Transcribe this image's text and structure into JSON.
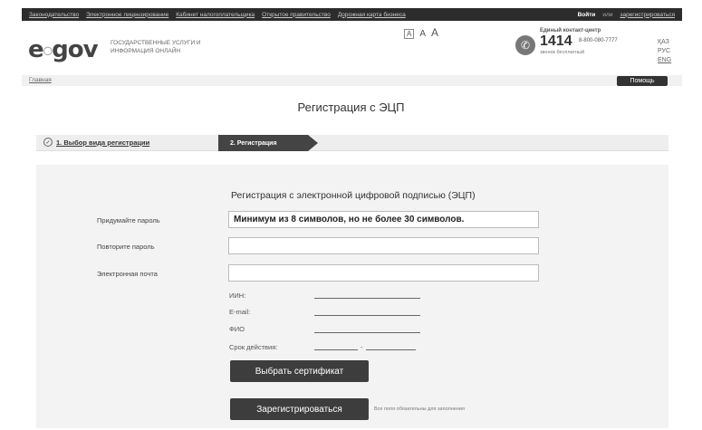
{
  "topnav": {
    "links": [
      "Законодательство",
      "Электронное лицензирование",
      "Кабинет налогоплательщика",
      "Открытое правительство",
      "Дорожная карта бизнеса"
    ],
    "login": "Войти",
    "or": "или",
    "register": "зарегистрироваться"
  },
  "header": {
    "logo": "e",
    "logo_rest": "gov",
    "tagline": "Государственные услуги и информация онлайн",
    "fontsize": [
      "A",
      "A",
      "A"
    ],
    "callcenter_title": "Единый контакт-центр",
    "callcenter_number": "1414",
    "callcenter_alt": "8-800-080-7777",
    "callcenter_free": "звонок бесплатный",
    "langs": [
      "ҚАЗ",
      "РУС",
      "ENG"
    ]
  },
  "breadcrumb": {
    "home": "Главная",
    "help": "Помощь"
  },
  "page_title": "Регистрация с ЭЦП",
  "steps": {
    "step1": "1. Выбор вида регистрации",
    "step2": "2. Регистрация"
  },
  "form": {
    "title": "Регистрация с электронной цифровой подписью (ЭЦП)",
    "password_label": "Придумайте пароль",
    "password_value": "Минимум из 8 символов, но не более 30 символов.",
    "repeat_label": "Повторите пароль",
    "email_label": "Электронная почта",
    "cert": {
      "iin": "ИИН:",
      "email": "E-mail:",
      "fio": "ФИО",
      "validity": "Срок действия:",
      "sep": "-"
    },
    "select_cert": "Выбрать сертификат",
    "register": "Зарегистрироваться",
    "note": "Все поля обязательны для заполнения"
  },
  "colors": {
    "dark": "#3d3d3d",
    "panel": "#f3f3f3"
  }
}
